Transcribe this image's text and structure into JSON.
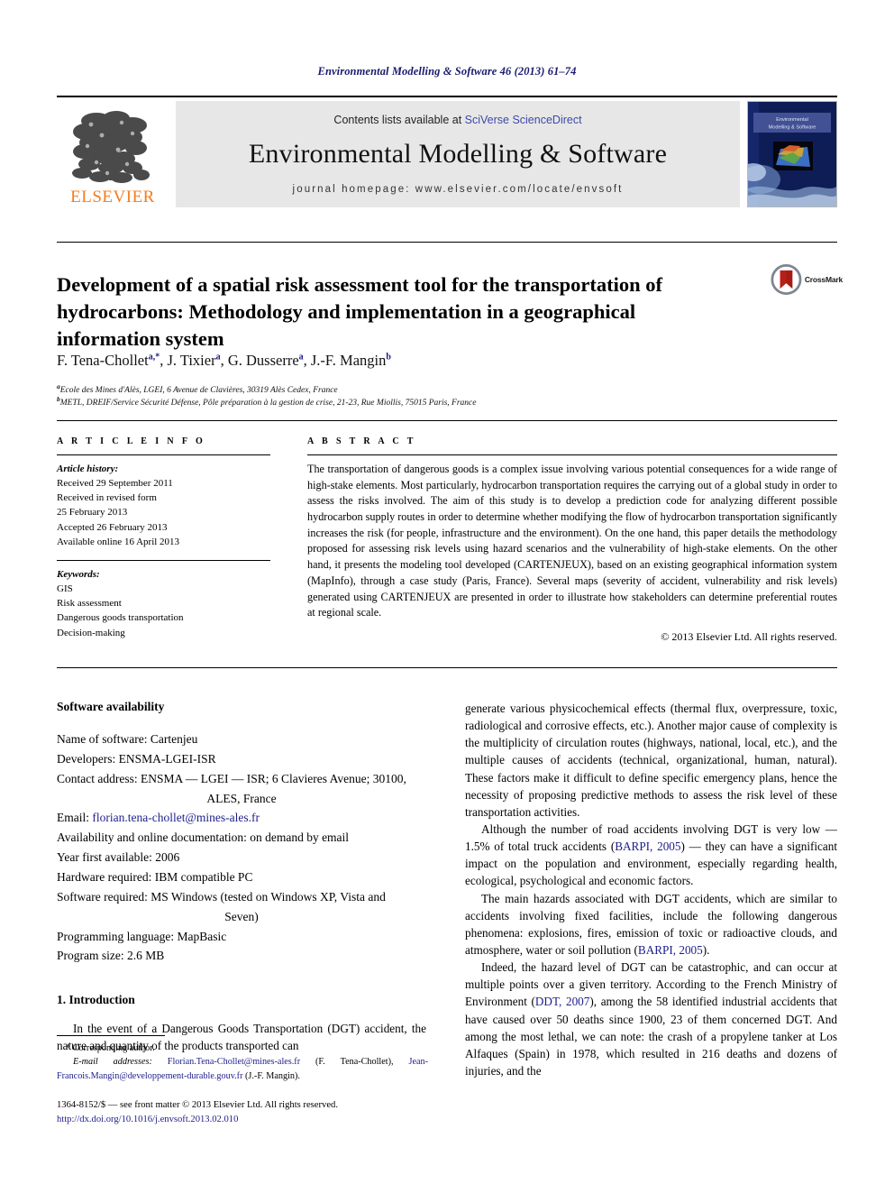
{
  "running_head": "Environmental Modelling & Software 46 (2013) 61–74",
  "masthead": {
    "publisher_name": "ELSEVIER",
    "contents_prefix": "Contents lists available at ",
    "contents_link": "SciVerse ScienceDirect",
    "journal_title": "Environmental Modelling & Software",
    "homepage_label": "journal homepage: www.elsevier.com/locate/envsoft",
    "cover_title_line1": "Environmental",
    "cover_title_line2": "Modelling & Software"
  },
  "article": {
    "title": "Development of a spatial risk assessment tool for the transportation of hydrocarbons: Methodology and implementation in a geographical information system",
    "crossmark_label": "CrossMark",
    "authors": [
      {
        "name": "F. Tena-Chollet",
        "marks": "a,*"
      },
      {
        "name": "J. Tixier",
        "marks": "a"
      },
      {
        "name": "G. Dusserre",
        "marks": "a"
      },
      {
        "name": "J.-F. Mangin",
        "marks": "b"
      }
    ],
    "affiliations": [
      {
        "mark": "a",
        "text": "Ecole des Mines d'Alès, LGEI, 6 Avenue de Clavières, 30319 Alès Cedex, France"
      },
      {
        "mark": "b",
        "text": "METL, DREIF/Service Sécurité Défense, Pôle préparation à la gestion de crise, 21-23, Rue Miollis, 75015 Paris, France"
      }
    ]
  },
  "article_info": {
    "heading": "A R T I C L E   I N F O",
    "history_label": "Article history:",
    "history": [
      "Received 29 September 2011",
      "Received in revised form",
      "25 February 2013",
      "Accepted 26 February 2013",
      "Available online 16 April 2013"
    ],
    "keywords_label": "Keywords:",
    "keywords": [
      "GIS",
      "Risk assessment",
      "Dangerous goods transportation",
      "Decision-making"
    ]
  },
  "abstract": {
    "heading": "A B S T R A C T",
    "text": "The transportation of dangerous goods is a complex issue involving various potential consequences for a wide range of high-stake elements. Most particularly, hydrocarbon transportation requires the carrying out of a global study in order to assess the risks involved. The aim of this study is to develop a prediction code for analyzing different possible hydrocarbon supply routes in order to determine whether modifying the flow of hydrocarbon transportation significantly increases the risk (for people, infrastructure and the environment). On the one hand, this paper details the methodology proposed for assessing risk levels using hazard scenarios and the vulnerability of high-stake elements. On the other hand, it presents the modeling tool developed (CARTENJEUX), based on an existing geographical information system (MapInfo), through a case study (Paris, France). Several maps (severity of accident, vulnerability and risk levels) generated using CARTENJEUX are presented in order to illustrate how stakeholders can determine preferential routes at regional scale.",
    "copyright": "© 2013 Elsevier Ltd. All rights reserved."
  },
  "software_availability": {
    "heading": "Software availability",
    "items": [
      {
        "label": "Name of software: ",
        "value": "Cartenjeu"
      },
      {
        "label": "Developers: ",
        "value": "ENSMA-LGEI-ISR"
      },
      {
        "label": "Contact address: ",
        "value": "ENSMA — LGEI — ISR; 6 Clavieres Avenue; 30100,",
        "continuation": "ALES, France"
      },
      {
        "label": "Email: ",
        "value": "florian.tena-chollet@mines-ales.fr",
        "is_link": true
      },
      {
        "label": "Availability and online documentation: ",
        "value": "on demand by email"
      },
      {
        "label": "Year first available: ",
        "value": "2006"
      },
      {
        "label": "Hardware required: ",
        "value": "IBM compatible PC"
      },
      {
        "label": "Software required: ",
        "value": "MS Windows (tested on Windows XP, Vista and",
        "continuation": "Seven)"
      },
      {
        "label": "Programming language: ",
        "value": "MapBasic"
      },
      {
        "label": "Program size: ",
        "value": "2.6 MB"
      }
    ]
  },
  "introduction": {
    "heading": "1. Introduction",
    "paragraph_left": "In the event of a Dangerous Goods Transportation (DGT) accident, the nature and quantity of the products transported can"
  },
  "right_column": {
    "p1": "generate various physicochemical effects (thermal flux, overpressure, toxic, radiological and corrosive effects, etc.). Another major cause of complexity is the multiplicity of circulation routes (highways, national, local, etc.), and the multiple causes of accidents (technical, organizational, human, natural). These factors make it difficult to define specific emergency plans, hence the necessity of proposing predictive methods to assess the risk level of these transportation activities.",
    "p2_a": "Although the number of road accidents involving DGT is very low — 1.5% of total truck accidents (",
    "p2_cite": "BARPI, 2005",
    "p2_b": ") — they can have a significant impact on the population and environment, especially regarding health, ecological, psychological and economic factors.",
    "p3_a": "The main hazards associated with DGT accidents, which are similar to accidents involving fixed facilities, include the following dangerous phenomena: explosions, fires, emission of toxic or radioactive clouds, and atmosphere, water or soil pollution (",
    "p3_cite": "BARPI, 2005",
    "p3_b": ").",
    "p4_a": "Indeed, the hazard level of DGT can be catastrophic, and can occur at multiple points over a given territory. According to the French Ministry of Environment (",
    "p4_cite": "DDT, 2007",
    "p4_b": "), among the 58 identified industrial accidents that have caused over 50 deaths since 1900, 23 of them concerned DGT. And among the most lethal, we can note: the crash of a propylene tanker at Los Alfaques (Spain) in 1978, which resulted in 216 deaths and dozens of injuries, and the"
  },
  "footer": {
    "corresponding_author": "* Corresponding author.",
    "email_label": "E-mail addresses:",
    "email_1": "Florian.Tena-Chollet@mines-ales.fr",
    "email_1_paren": "(F. Tena-Chollet),",
    "email_2": "Jean-Francois.Mangin@developpement-durable.gouv.fr",
    "email_2_paren": "(J.-F. Mangin).",
    "issn_line": "1364-8152/$ — see front matter © 2013 Elsevier Ltd. All rights reserved.",
    "doi_line": "http://dx.doi.org/10.1016/j.envsoft.2013.02.010"
  },
  "colors": {
    "elsevier_orange": "#F57C20",
    "link_blue": "#1d1d8c",
    "running_head_navy": "#1a1a6e",
    "band_grey": "#e7e7e7"
  }
}
